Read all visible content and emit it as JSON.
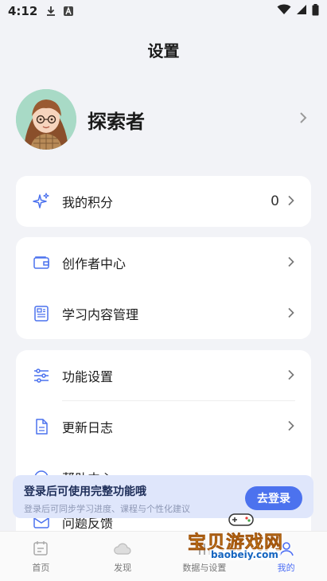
{
  "status_bar": {
    "time": "4:12"
  },
  "header": {
    "title": "设置"
  },
  "profile": {
    "name": "探索者"
  },
  "points_card": {
    "label": "我的积分",
    "value": "0"
  },
  "creator_card": {
    "items": [
      {
        "label": "创作者中心"
      },
      {
        "label": "学习内容管理"
      }
    ]
  },
  "settings_card": {
    "items": [
      {
        "label": "功能设置"
      },
      {
        "label": "更新日志"
      },
      {
        "label": "帮助中心"
      },
      {
        "label": "问题反馈"
      }
    ]
  },
  "login_banner": {
    "title": "登录后可使用完整功能哦",
    "subtitle": "登录后可同步学习进度、课程与个性化建议",
    "button": "去登录"
  },
  "tabbar": {
    "tabs": [
      {
        "label": "首页"
      },
      {
        "label": "发现"
      },
      {
        "label": "数据与设置"
      },
      {
        "label": "我的"
      }
    ]
  },
  "watermark": {
    "text": "宝贝游戏网",
    "url": "baobeiy.com"
  },
  "colors": {
    "accent": "#4c72ee",
    "banner_bg": "#dfe6fb",
    "page_bg": "#f2f3f7"
  }
}
